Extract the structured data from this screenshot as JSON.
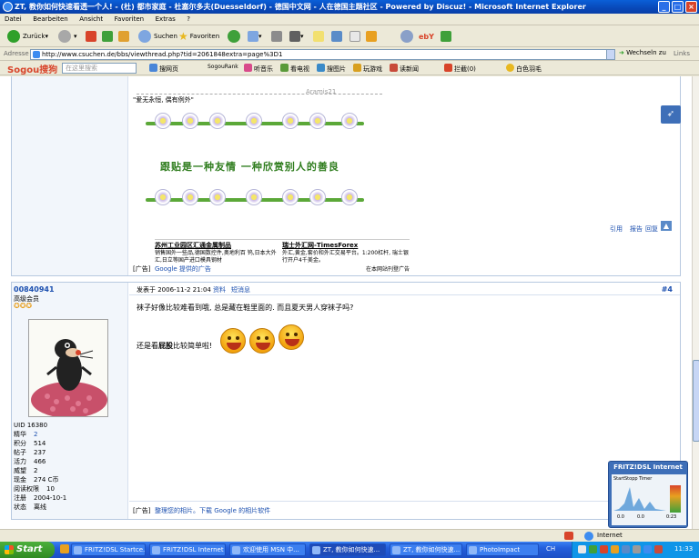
{
  "window": {
    "title": "ZT, 教你如何快速看透一个人! - (杜) 都市家庭 - 杜塞尔多夫(Duesseldorf) - 德国中文网 - 人在德国主题社区 - Powered by Discuz! - Microsoft Internet Explorer"
  },
  "menu": [
    "Datei",
    "Bearbeiten",
    "Ansicht",
    "Favoriten",
    "Extras",
    "?"
  ],
  "toolbar": {
    "back": "Zurück",
    "search": "Suchen",
    "favorites": "Favoriten"
  },
  "address": {
    "label": "Adresse",
    "url": "http://www.csuchen.de/bbs/viewthread.php?tid=2061848extra=page%3D1",
    "go": "Wechseln zu",
    "links": "Links"
  },
  "sogou": {
    "logo": "Sogou搜狗",
    "search_placeholder": "在这里搜索",
    "items": [
      "搜网页",
      "SogouRank",
      "听音乐",
      "看电视",
      "搜图片",
      "玩游戏",
      "读新闻",
      "拦截(0)",
      "白色羽毛"
    ]
  },
  "post3": {
    "edited": "Aramis21",
    "quote": "\"爱无永恒, 偶有例外\"",
    "slogan": "跟贴是一种友情  一种欣赏别人的善良",
    "actions": [
      "引用",
      "报告",
      "回复"
    ],
    "ad1_title": "苏州工业园区汇通金属制品",
    "ad1_text": "销售国外一些品,德国数控件,奥地利百 钨,日本大外汇,日立等国产进口模具钢材",
    "ad2_title": "瑞士外汇网-TimesForex",
    "ad2_text": "外汇,黄金,套价和外汇交易平台。1:200杠杆, 瑞士银行开户4千美金。",
    "ad_label": "[广告]",
    "ad_google": "Google 提供的广告",
    "ad_more": "在本网站刊登广告"
  },
  "post4": {
    "username": "00840941",
    "rank": "高级会员",
    "posted": "发表于 2006-11-2 21:04",
    "profile": "资料",
    "pm": "短消息",
    "floor": "#4",
    "line1": "袜子好像比较难看到哦, 总是藏在鞋里面的. 而且夏天男人穿袜子吗?",
    "line2_pre": "还是看",
    "line2_bold": "屁股",
    "line2_post": "比较简单啦!",
    "stats": [
      {
        "k": "UID",
        "v": "16380"
      },
      {
        "k": "精华",
        "v": "2"
      },
      {
        "k": "积分",
        "v": "514"
      },
      {
        "k": "帖子",
        "v": "237"
      },
      {
        "k": "活力",
        "v": "466"
      },
      {
        "k": "威望",
        "v": "2"
      },
      {
        "k": "现金",
        "v": "274 C币"
      },
      {
        "k": "阅读权限",
        "v": "10"
      },
      {
        "k": "注册",
        "v": "2004-10-1"
      },
      {
        "k": "状态",
        "v": "离线"
      }
    ],
    "footer_ad_label": "[广告]",
    "footer_ad": "整理您的相片。下载 Google 的相片软件"
  },
  "fritz": {
    "title": "FRITZ!DSL Internet",
    "tabs": [
      "Start",
      "Stopp",
      "Timer"
    ],
    "val1": "0.0",
    "val2": "0.0",
    "val3": "0:23"
  },
  "status": {
    "zone": "Internet"
  },
  "taskbar": {
    "start": "Start",
    "tasks": [
      "FRITZ!DSL Startce...",
      "FRITZ!DSL Internet",
      "欢迎使用 MSN 中...",
      "ZT, 教你如何快速...",
      "ZT, 教你如何快速...",
      "PhotoImpact"
    ],
    "lang": "CH",
    "time": "11:33"
  }
}
